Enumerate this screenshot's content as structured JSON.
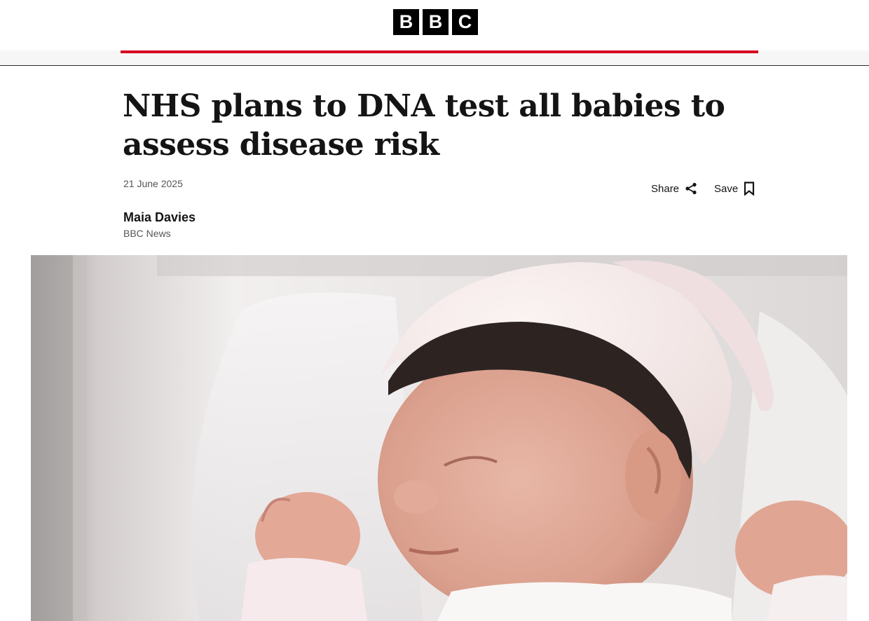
{
  "masthead": {
    "logo_letters": [
      "B",
      "B",
      "C"
    ]
  },
  "article": {
    "headline": "NHS plans to DNA test all babies to assess disease risk",
    "date": "21 June 2025",
    "author": "Maia Davies",
    "author_org": "BBC News"
  },
  "actions": {
    "share_label": "Share",
    "save_label": "Save"
  },
  "icons": {
    "share": "share-icon",
    "save": "bookmark-icon"
  },
  "colors": {
    "accent_red": "#d5001f",
    "text": "#141414",
    "muted": "#545658"
  }
}
